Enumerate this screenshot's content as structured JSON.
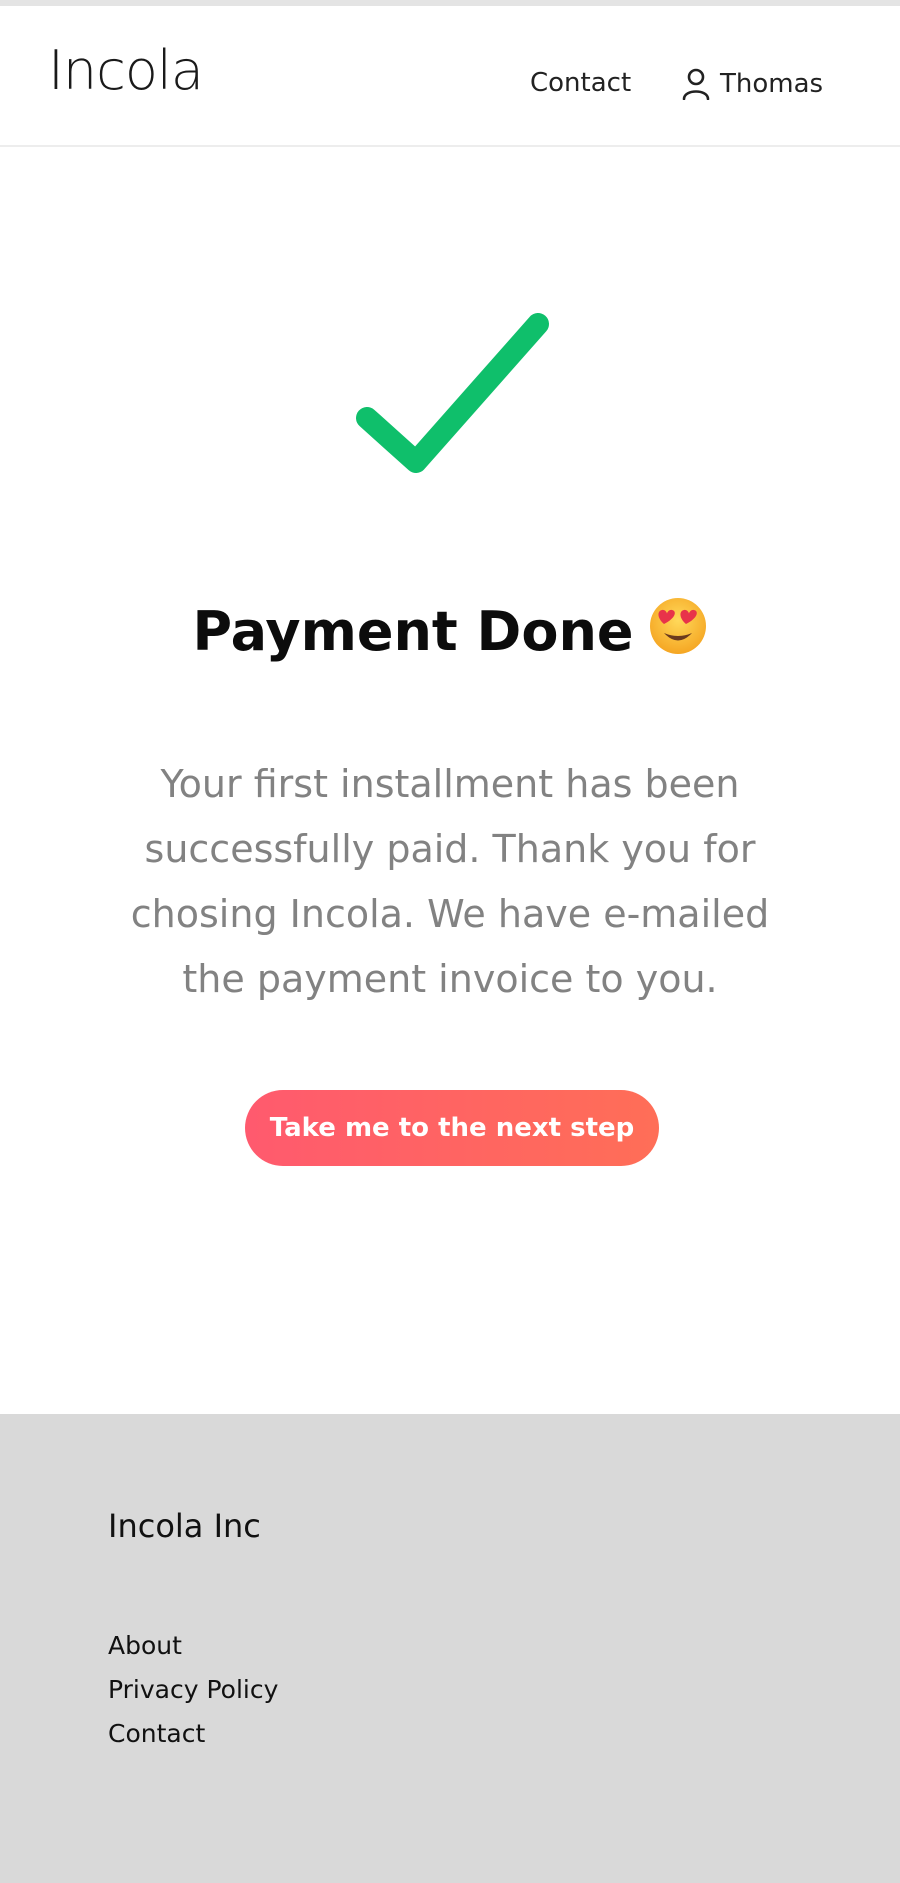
{
  "header": {
    "logo": "Incola",
    "nav_contact": "Contact",
    "user_name": "Thomas"
  },
  "icons": {
    "user": "user-icon",
    "success": "checkmark-icon",
    "emoji": "heart-eyes-emoji"
  },
  "main": {
    "title": "Payment Done",
    "message": "Your first installment has been successfully paid. Thank you for chosing Incola. We have e-mailed the payment invoice to you.",
    "cta_label": "Take me to the next step"
  },
  "footer": {
    "brand": "Incola Inc",
    "links": [
      "About",
      "Privacy Policy",
      "Contact"
    ]
  },
  "colors": {
    "check": "#0fbf6b",
    "cta_start": "#ff5a6e",
    "cta_end": "#ff6e57",
    "footer_bg": "#d9d9d9"
  }
}
